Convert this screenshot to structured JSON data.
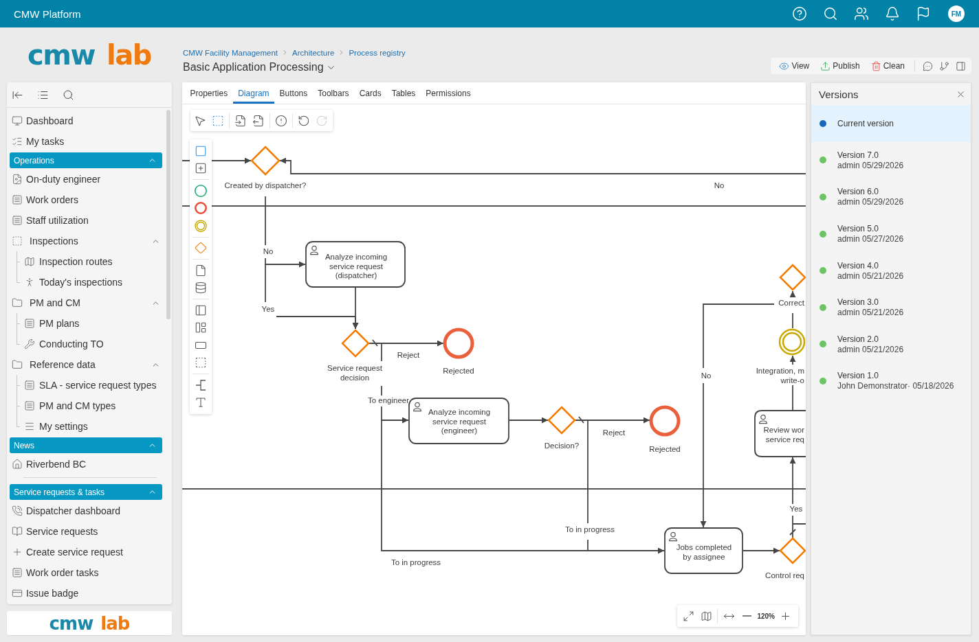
{
  "top_bar": {
    "title": "CMW Platform",
    "avatar_initials": "FM"
  },
  "logo": {
    "primary": "cmw",
    "accent": "lab"
  },
  "sidebar": {
    "items": [
      {
        "kind": "link",
        "label": "Dashboard"
      },
      {
        "kind": "link",
        "label": "My tasks"
      },
      {
        "kind": "section",
        "label": "Operations",
        "expanded": true,
        "children": [
          {
            "kind": "link",
            "label": "On-duty engineer"
          },
          {
            "kind": "link",
            "label": "Work orders"
          },
          {
            "kind": "link",
            "label": "Staff utilization"
          },
          {
            "kind": "group",
            "label": "Inspections",
            "expanded": true,
            "children": [
              {
                "kind": "link",
                "label": "Inspection routes"
              },
              {
                "kind": "link",
                "label": "Today's inspections"
              }
            ]
          },
          {
            "kind": "group",
            "label": "PM and CM",
            "expanded": true,
            "children": [
              {
                "kind": "link",
                "label": "PM plans"
              },
              {
                "kind": "link",
                "label": "Conducting TO"
              }
            ]
          },
          {
            "kind": "group",
            "label": "Reference data",
            "expanded": true,
            "children": [
              {
                "kind": "link",
                "label": "SLA - service request types"
              },
              {
                "kind": "link",
                "label": "PM and CM types"
              },
              {
                "kind": "link",
                "label": "My settings"
              }
            ]
          }
        ]
      },
      {
        "kind": "section",
        "label": "News",
        "expanded": true,
        "children": [
          {
            "kind": "link",
            "label": "Riverbend BC"
          }
        ]
      },
      {
        "kind": "divider"
      },
      {
        "kind": "section",
        "label": "Service requests & tasks",
        "expanded": true,
        "children": [
          {
            "kind": "link",
            "label": "Dispatcher dashboard"
          },
          {
            "kind": "link",
            "label": "Service requests"
          },
          {
            "kind": "link",
            "label": "Create service request"
          },
          {
            "kind": "link",
            "label": "Work order tasks"
          },
          {
            "kind": "link",
            "label": "Issue badge"
          }
        ]
      }
    ]
  },
  "footer_logo": {
    "primary": "cmw",
    "accent": "lab"
  },
  "breadcrumbs": [
    "CMW Facility Management",
    "Architecture",
    "Process registry"
  ],
  "page_title": "Basic Application Processing",
  "actions": [
    "View",
    "Publish",
    "Clean"
  ],
  "tabs": [
    {
      "label": "Properties",
      "selected": false
    },
    {
      "label": "Diagram",
      "selected": true
    },
    {
      "label": "Buttons",
      "selected": false
    },
    {
      "label": "Toolbars",
      "selected": false
    },
    {
      "label": "Cards",
      "selected": false
    },
    {
      "label": "Tables",
      "selected": false
    },
    {
      "label": "Permissions",
      "selected": false
    }
  ],
  "canvas_toolbar": {
    "undo": {
      "disabled": false
    },
    "redo": {
      "disabled": true
    }
  },
  "diagram": {
    "nodes": [
      {
        "kind": "gateway",
        "label": "Created by dispatcher?"
      },
      {
        "kind": "task",
        "label": "Analyze incoming\nservice request\n(dispatcher)"
      },
      {
        "kind": "gateway",
        "label": "Service request\ndecision"
      },
      {
        "kind": "end_event",
        "label": "Rejected"
      },
      {
        "kind": "task",
        "label": "Analyze incoming\nservice request\n(engineer)"
      },
      {
        "kind": "gateway",
        "label": "Decision?"
      },
      {
        "kind": "end_event",
        "label": "Rejected"
      },
      {
        "kind": "task",
        "label": "Jobs completed\nby assignee"
      },
      {
        "kind": "gateway",
        "label": "Correct"
      },
      {
        "kind": "intermediate_event",
        "label": "Integration, m\nwrite-o"
      },
      {
        "kind": "task",
        "label": "Review wor\nservice req"
      },
      {
        "kind": "gateway",
        "label": "Control req"
      }
    ],
    "flow_labels": [
      "No",
      "No",
      "Yes",
      "Reject",
      "To engineer",
      "Reject",
      "To in progress",
      "To in progress",
      "No",
      "Yes"
    ]
  },
  "zoom": {
    "reading": "120%"
  },
  "versions": {
    "title": "Versions",
    "items": [
      {
        "title": "Current version",
        "selected": true,
        "color": "#1a66b8"
      },
      {
        "title": "Version 7.0",
        "subtitle": "admin 05/29/2026",
        "selected": false,
        "color": "#6cc464"
      },
      {
        "title": "Version 6.0",
        "subtitle": "admin 05/29/2026",
        "selected": false,
        "color": "#6cc464"
      },
      {
        "title": "Version 5.0",
        "subtitle": "admin 05/27/2026",
        "selected": false,
        "color": "#6cc464"
      },
      {
        "title": "Version 4.0",
        "subtitle": "admin 05/21/2026",
        "selected": false,
        "color": "#6cc464"
      },
      {
        "title": "Version 3.0",
        "subtitle": "admin 05/21/2026",
        "selected": false,
        "color": "#6cc464"
      },
      {
        "title": "Version 2.0",
        "subtitle": "admin 05/21/2026",
        "selected": false,
        "color": "#6cc464"
      },
      {
        "title": "Version 1.0",
        "subtitle": "John Demonstrator· 05/18/2026",
        "selected": false,
        "color": "#6cc464"
      }
    ]
  }
}
